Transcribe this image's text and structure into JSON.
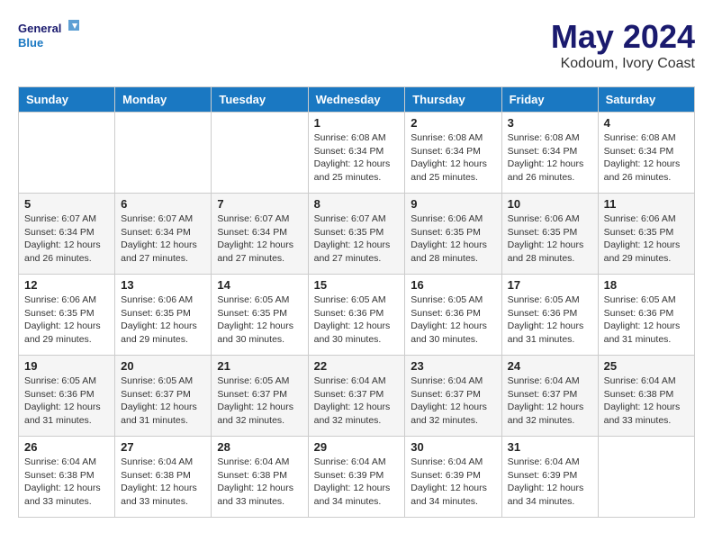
{
  "logo": {
    "line1": "General",
    "line2": "Blue"
  },
  "title": "May 2024",
  "location": "Kodoum, Ivory Coast",
  "days_header": [
    "Sunday",
    "Monday",
    "Tuesday",
    "Wednesday",
    "Thursday",
    "Friday",
    "Saturday"
  ],
  "weeks": [
    [
      {
        "num": "",
        "info": ""
      },
      {
        "num": "",
        "info": ""
      },
      {
        "num": "",
        "info": ""
      },
      {
        "num": "1",
        "info": "Sunrise: 6:08 AM\nSunset: 6:34 PM\nDaylight: 12 hours\nand 25 minutes."
      },
      {
        "num": "2",
        "info": "Sunrise: 6:08 AM\nSunset: 6:34 PM\nDaylight: 12 hours\nand 25 minutes."
      },
      {
        "num": "3",
        "info": "Sunrise: 6:08 AM\nSunset: 6:34 PM\nDaylight: 12 hours\nand 26 minutes."
      },
      {
        "num": "4",
        "info": "Sunrise: 6:08 AM\nSunset: 6:34 PM\nDaylight: 12 hours\nand 26 minutes."
      }
    ],
    [
      {
        "num": "5",
        "info": "Sunrise: 6:07 AM\nSunset: 6:34 PM\nDaylight: 12 hours\nand 26 minutes."
      },
      {
        "num": "6",
        "info": "Sunrise: 6:07 AM\nSunset: 6:34 PM\nDaylight: 12 hours\nand 27 minutes."
      },
      {
        "num": "7",
        "info": "Sunrise: 6:07 AM\nSunset: 6:34 PM\nDaylight: 12 hours\nand 27 minutes."
      },
      {
        "num": "8",
        "info": "Sunrise: 6:07 AM\nSunset: 6:35 PM\nDaylight: 12 hours\nand 27 minutes."
      },
      {
        "num": "9",
        "info": "Sunrise: 6:06 AM\nSunset: 6:35 PM\nDaylight: 12 hours\nand 28 minutes."
      },
      {
        "num": "10",
        "info": "Sunrise: 6:06 AM\nSunset: 6:35 PM\nDaylight: 12 hours\nand 28 minutes."
      },
      {
        "num": "11",
        "info": "Sunrise: 6:06 AM\nSunset: 6:35 PM\nDaylight: 12 hours\nand 29 minutes."
      }
    ],
    [
      {
        "num": "12",
        "info": "Sunrise: 6:06 AM\nSunset: 6:35 PM\nDaylight: 12 hours\nand 29 minutes."
      },
      {
        "num": "13",
        "info": "Sunrise: 6:06 AM\nSunset: 6:35 PM\nDaylight: 12 hours\nand 29 minutes."
      },
      {
        "num": "14",
        "info": "Sunrise: 6:05 AM\nSunset: 6:35 PM\nDaylight: 12 hours\nand 30 minutes."
      },
      {
        "num": "15",
        "info": "Sunrise: 6:05 AM\nSunset: 6:36 PM\nDaylight: 12 hours\nand 30 minutes."
      },
      {
        "num": "16",
        "info": "Sunrise: 6:05 AM\nSunset: 6:36 PM\nDaylight: 12 hours\nand 30 minutes."
      },
      {
        "num": "17",
        "info": "Sunrise: 6:05 AM\nSunset: 6:36 PM\nDaylight: 12 hours\nand 31 minutes."
      },
      {
        "num": "18",
        "info": "Sunrise: 6:05 AM\nSunset: 6:36 PM\nDaylight: 12 hours\nand 31 minutes."
      }
    ],
    [
      {
        "num": "19",
        "info": "Sunrise: 6:05 AM\nSunset: 6:36 PM\nDaylight: 12 hours\nand 31 minutes."
      },
      {
        "num": "20",
        "info": "Sunrise: 6:05 AM\nSunset: 6:37 PM\nDaylight: 12 hours\nand 31 minutes."
      },
      {
        "num": "21",
        "info": "Sunrise: 6:05 AM\nSunset: 6:37 PM\nDaylight: 12 hours\nand 32 minutes."
      },
      {
        "num": "22",
        "info": "Sunrise: 6:04 AM\nSunset: 6:37 PM\nDaylight: 12 hours\nand 32 minutes."
      },
      {
        "num": "23",
        "info": "Sunrise: 6:04 AM\nSunset: 6:37 PM\nDaylight: 12 hours\nand 32 minutes."
      },
      {
        "num": "24",
        "info": "Sunrise: 6:04 AM\nSunset: 6:37 PM\nDaylight: 12 hours\nand 32 minutes."
      },
      {
        "num": "25",
        "info": "Sunrise: 6:04 AM\nSunset: 6:38 PM\nDaylight: 12 hours\nand 33 minutes."
      }
    ],
    [
      {
        "num": "26",
        "info": "Sunrise: 6:04 AM\nSunset: 6:38 PM\nDaylight: 12 hours\nand 33 minutes."
      },
      {
        "num": "27",
        "info": "Sunrise: 6:04 AM\nSunset: 6:38 PM\nDaylight: 12 hours\nand 33 minutes."
      },
      {
        "num": "28",
        "info": "Sunrise: 6:04 AM\nSunset: 6:38 PM\nDaylight: 12 hours\nand 33 minutes."
      },
      {
        "num": "29",
        "info": "Sunrise: 6:04 AM\nSunset: 6:39 PM\nDaylight: 12 hours\nand 34 minutes."
      },
      {
        "num": "30",
        "info": "Sunrise: 6:04 AM\nSunset: 6:39 PM\nDaylight: 12 hours\nand 34 minutes."
      },
      {
        "num": "31",
        "info": "Sunrise: 6:04 AM\nSunset: 6:39 PM\nDaylight: 12 hours\nand 34 minutes."
      },
      {
        "num": "",
        "info": ""
      }
    ]
  ]
}
